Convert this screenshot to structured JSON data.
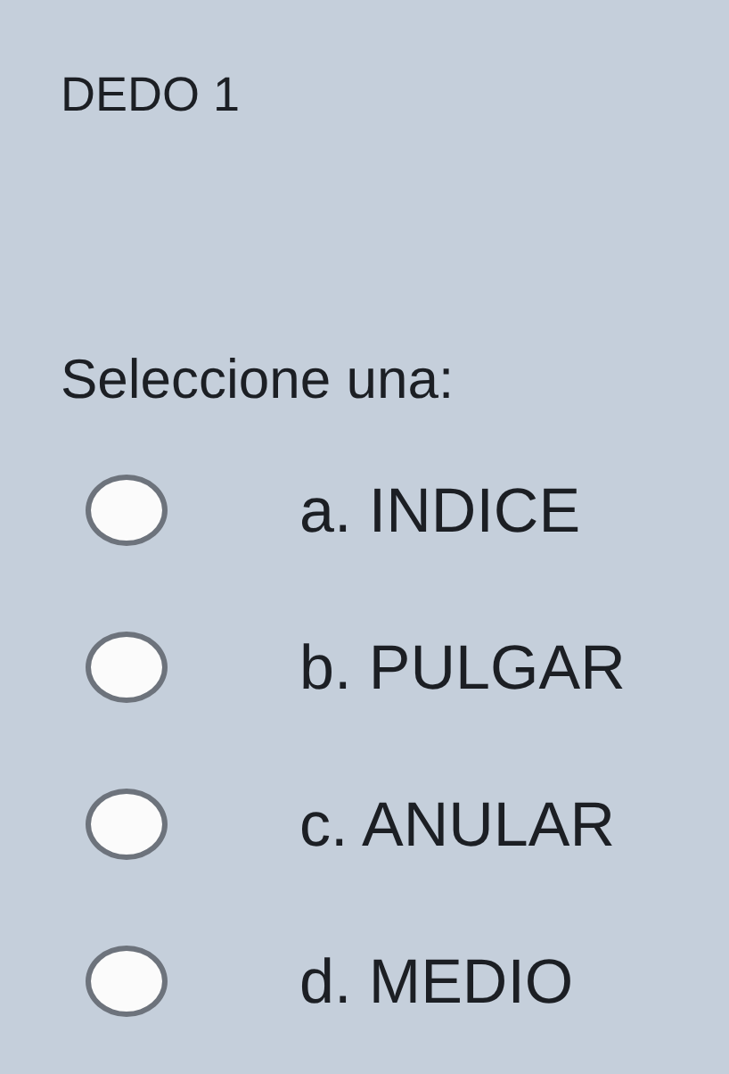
{
  "question": {
    "title": "DEDO 1",
    "prompt": "Seleccione una:",
    "options": [
      {
        "label": "a. INDICE",
        "selected": false
      },
      {
        "label": "b. PULGAR",
        "selected": false
      },
      {
        "label": "c. ANULAR",
        "selected": false
      },
      {
        "label": "d. MEDIO",
        "selected": false
      }
    ]
  }
}
